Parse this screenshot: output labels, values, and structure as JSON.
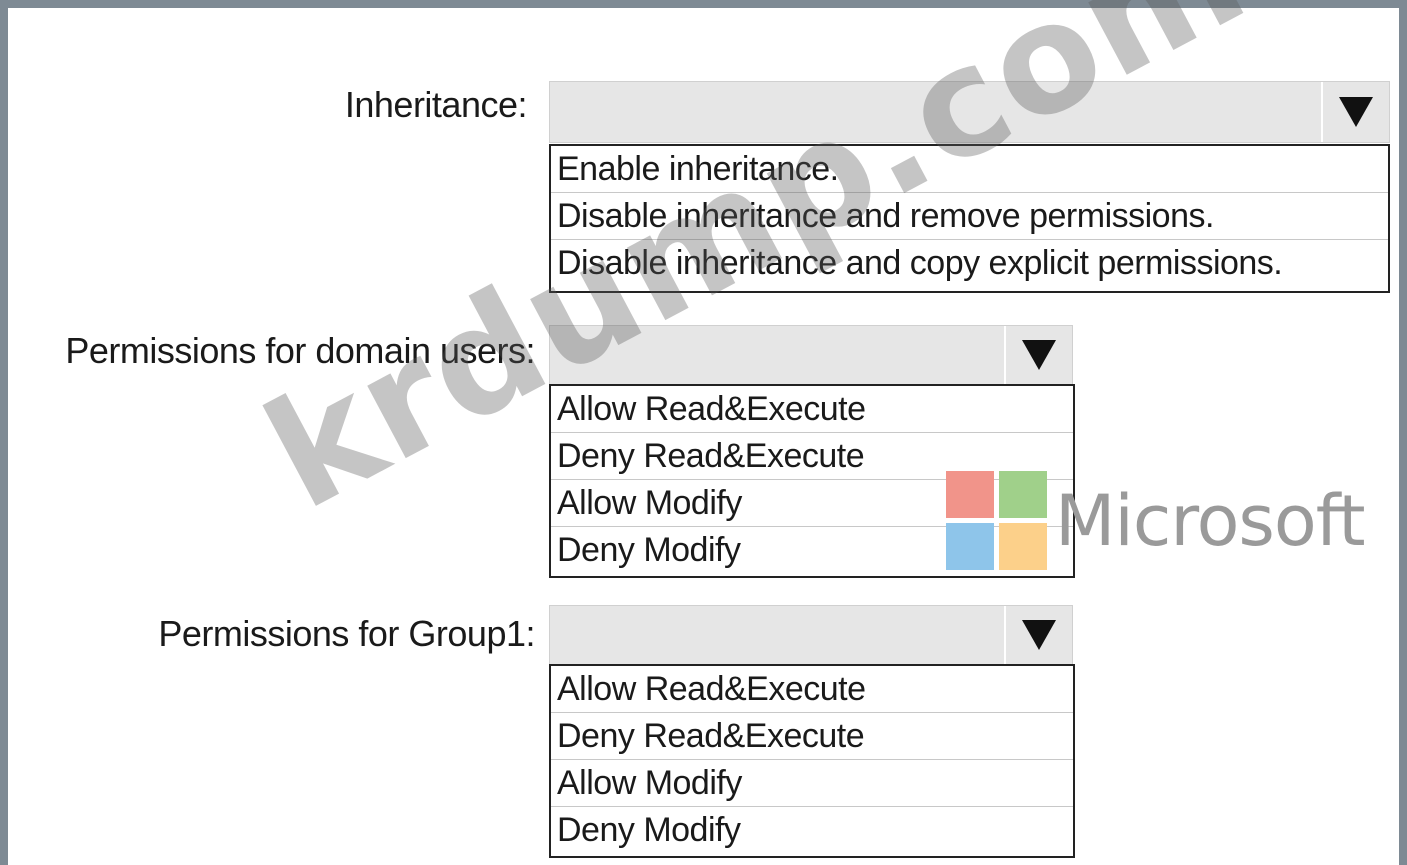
{
  "inheritance": {
    "label": "Inheritance:",
    "selected": "",
    "options": [
      "Enable inheritance.",
      "Disable inheritance and remove permissions.",
      "Disable inheritance and copy explicit permissions."
    ]
  },
  "domain_users": {
    "label": "Permissions for domain users:",
    "selected": "",
    "options": [
      "Allow Read&Execute",
      "Deny Read&Execute",
      "Allow Modify",
      "Deny Modify"
    ]
  },
  "group1": {
    "label": "Permissions for Group1:",
    "selected": "",
    "options": [
      "Allow Read&Execute",
      "Deny Read&Execute",
      "Allow Modify",
      "Deny Modify"
    ]
  },
  "branding": {
    "microsoft_text": "Microsoft",
    "logo_colors": [
      "#f1948a",
      "#a0d08a",
      "#8ec5ea",
      "#fcd08a"
    ],
    "watermark": "krdump.com"
  },
  "colors": {
    "frame": "#7e8a94",
    "select_bg": "#e6e6e6"
  }
}
